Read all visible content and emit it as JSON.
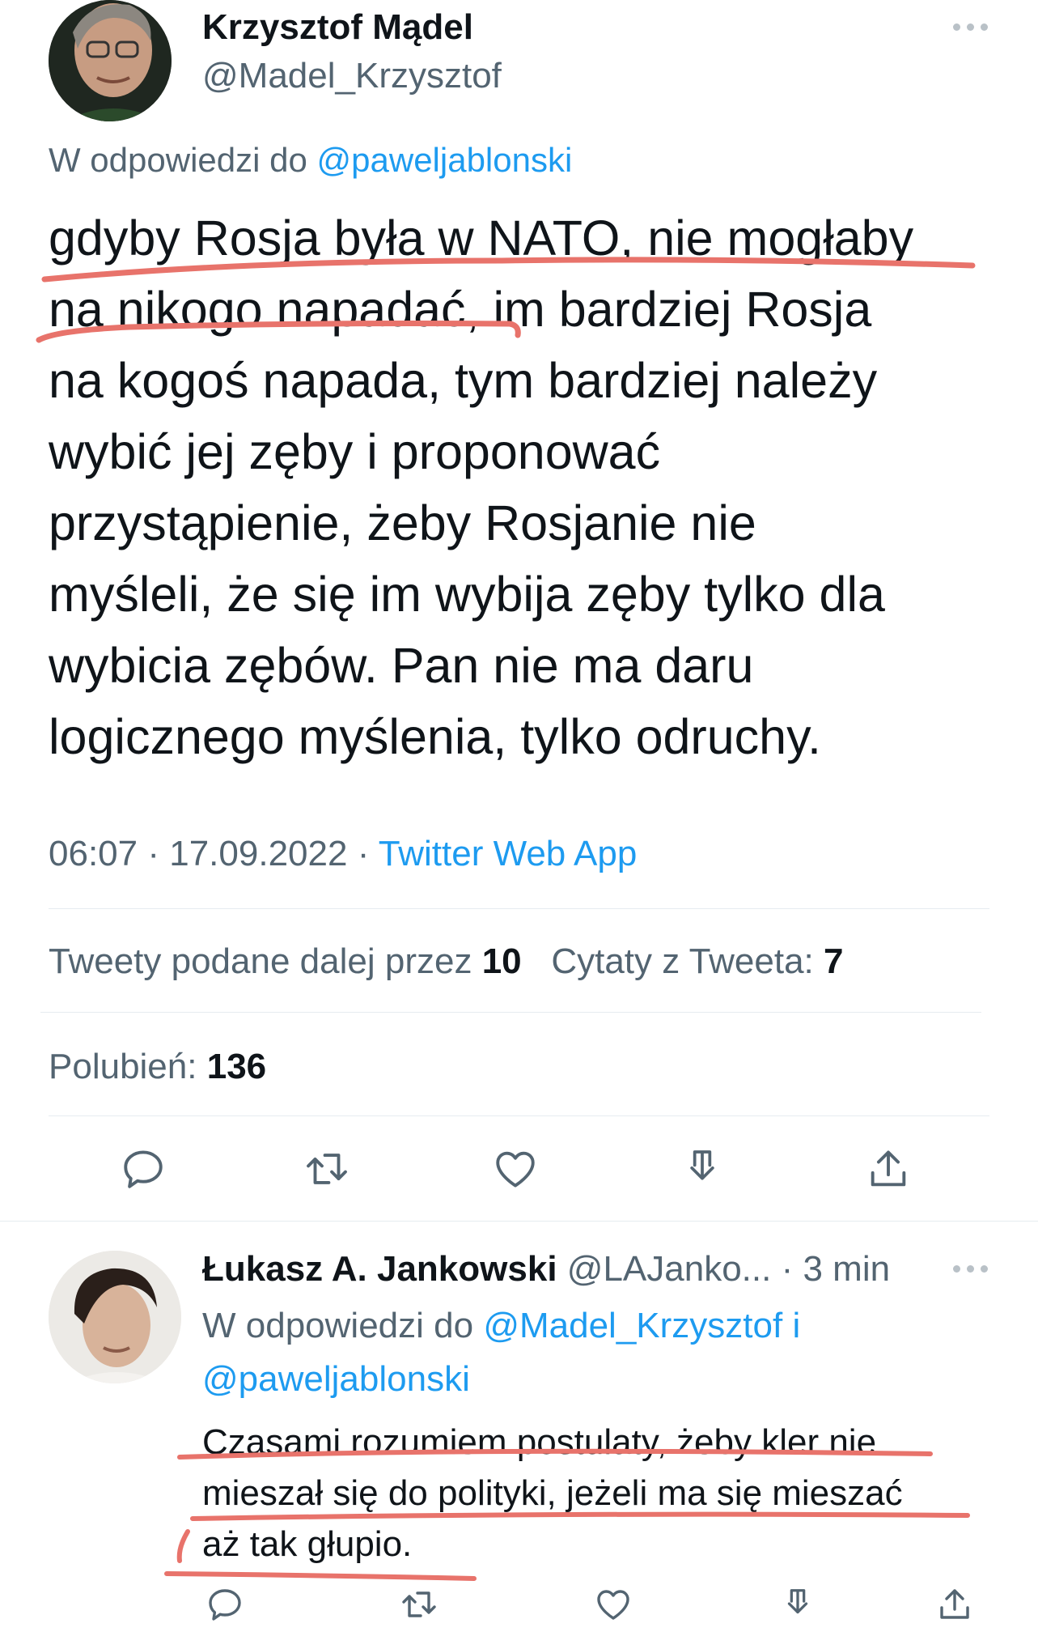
{
  "main_tweet": {
    "author_name": "Krzysztof Mądel",
    "author_handle": "@Madel_Krzysztof",
    "reply_prefix": "W odpowiedzi do",
    "reply_to": "@paweljablonski",
    "text_lines": [
      "gdyby Rosja była w NATO, nie mogłaby",
      "na nikogo napadać, im bardziej Rosja",
      "na kogoś napada, tym bardziej należy",
      "wybić jej zęby i proponować",
      "przystąpienie, żeby Rosjanie nie",
      "myśleli, że się im wybija zęby tylko dla",
      "wybicia zębów. Pan nie ma daru",
      "logicznego myślenia, tylko odruchy."
    ],
    "time": "06:07",
    "separator": "·",
    "date": "17.09.2022",
    "source": "Twitter Web App",
    "retweets_label": "Tweety podane dalej przez",
    "retweets_count": "10",
    "quotes_label": "Cytaty z Tweeta:",
    "quotes_count": "7",
    "likes_label": "Polubień:",
    "likes_count": "136"
  },
  "reply_tweet": {
    "author_name": "Łukasz A. Jankowski",
    "author_handle": "@LAJanko...",
    "separator": "·",
    "time_ago": "3 min",
    "reply_prefix": "W odpowiedzi do",
    "reply_to_1": "@Madel_Krzysztof",
    "conjunction": "i",
    "reply_to_2": "@paweljablonski",
    "text_lines": [
      "Czasami rozumiem postulaty, żeby kler nie",
      "mieszał się do polityki, jeżeli ma się mieszać",
      "aż tak głupio."
    ]
  },
  "icons": [
    "more-icon",
    "reply-icon",
    "retweet-icon",
    "like-icon",
    "bookmark-icon",
    "share-icon"
  ],
  "colors": {
    "link": "#1d9bf0",
    "muted": "#536471",
    "annotation": "#e8736b"
  }
}
